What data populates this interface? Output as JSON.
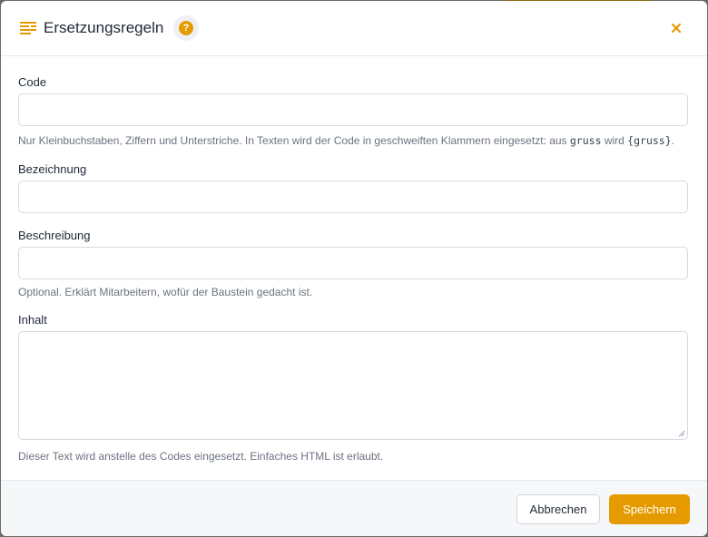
{
  "dialog": {
    "title": "Ersetzungsregeln",
    "help_icon": "help-icon",
    "title_icon": "text-lines-icon",
    "close_icon": "close-icon"
  },
  "form": {
    "code": {
      "label": "Code",
      "value": "",
      "hint_prefix": "Nur Kleinbuchstaben, Ziffern und Unterstriche. In Texten wird der Code in geschweiften Klammern eingesetzt: aus ",
      "hint_code": "gruss",
      "hint_mid": " wird ",
      "hint_code_braced": "{gruss}",
      "hint_suffix": "."
    },
    "bezeichnung": {
      "label": "Bezeichnung",
      "value": ""
    },
    "beschreibung": {
      "label": "Beschreibung",
      "value": "",
      "hint": "Optional. Erklärt Mitarbeitern, wofür der Baustein gedacht ist."
    },
    "inhalt": {
      "label": "Inhalt",
      "value": "",
      "hint": "Dieser Text wird anstelle des Codes eingesetzt. Einfaches HTML ist erlaubt."
    }
  },
  "footer": {
    "cancel_label": "Abbrechen",
    "save_label": "Speichern"
  },
  "colors": {
    "accent": "#e59b00",
    "text": "#1f2937",
    "muted": "#6b7280"
  }
}
